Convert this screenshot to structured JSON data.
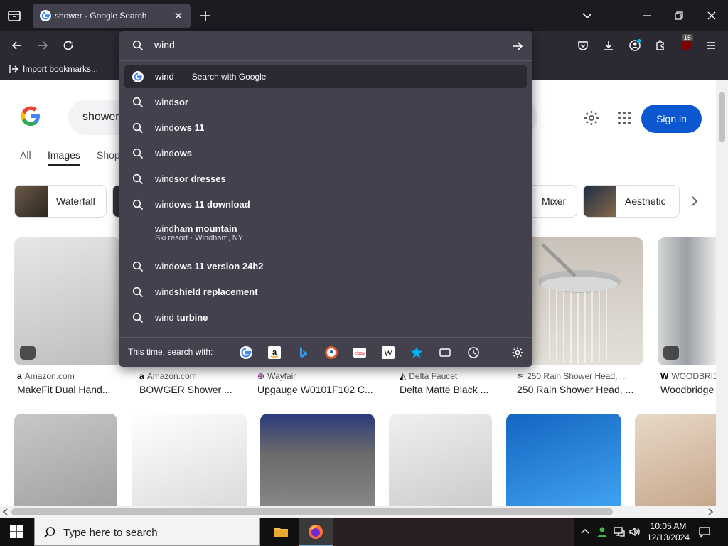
{
  "tab": {
    "title": "shower - Google Search"
  },
  "bookmarks": {
    "import_label": "Import bookmarks..."
  },
  "toolbar": {
    "badge_count": "15"
  },
  "urlbar": {
    "value": "wind",
    "suggestions": [
      {
        "prefix": "wind",
        "rest": "",
        "separator": "—",
        "hint": "Search with Google",
        "type": "google"
      },
      {
        "prefix": "wind",
        "rest": "sor"
      },
      {
        "prefix": "wind",
        "rest": "ows 11"
      },
      {
        "prefix": "wind",
        "rest": "ows"
      },
      {
        "prefix": "wind",
        "rest": "sor dresses"
      },
      {
        "prefix": "wind",
        "rest": "ows 11 download"
      },
      {
        "prefix": "wind",
        "rest": "ham mountain",
        "sub": "Ski resort · Windham, NY"
      },
      {
        "prefix": "wind",
        "rest": "ows 11 version 24h2"
      },
      {
        "prefix": "wind",
        "rest": "shield replacement"
      },
      {
        "prefix": "wind",
        "rest": " turbine"
      }
    ],
    "search_with_label": "This time, search with:"
  },
  "google": {
    "query": "shower",
    "signin_label": "Sign in",
    "tabs": [
      "All",
      "Images",
      "Shop"
    ],
    "chips": [
      "Waterfall",
      "Mixer",
      "Aesthetic"
    ],
    "results": [
      {
        "source": "Amazon.com",
        "title": "MakeFit Dual Hand..."
      },
      {
        "source": "Amazon.com",
        "title": "BOWGER Shower ..."
      },
      {
        "source": "Wayfair",
        "title": "Upgauge W0101F102 C..."
      },
      {
        "source": "Delta Faucet",
        "title": "Delta Matte Black ..."
      },
      {
        "source": "250 Rain Shower Head, ...",
        "title": "250 Rain Shower Head, ..."
      },
      {
        "source": "WOODBRID",
        "title": "Woodbridge"
      }
    ]
  },
  "taskbar": {
    "search_placeholder": "Type here to search",
    "time": "10:05 AM",
    "date": "12/13/2024"
  },
  "colors": {
    "accent": "#0b57d0",
    "chrome_bg": "#1c1b22",
    "dropdown_bg": "#42414d"
  }
}
